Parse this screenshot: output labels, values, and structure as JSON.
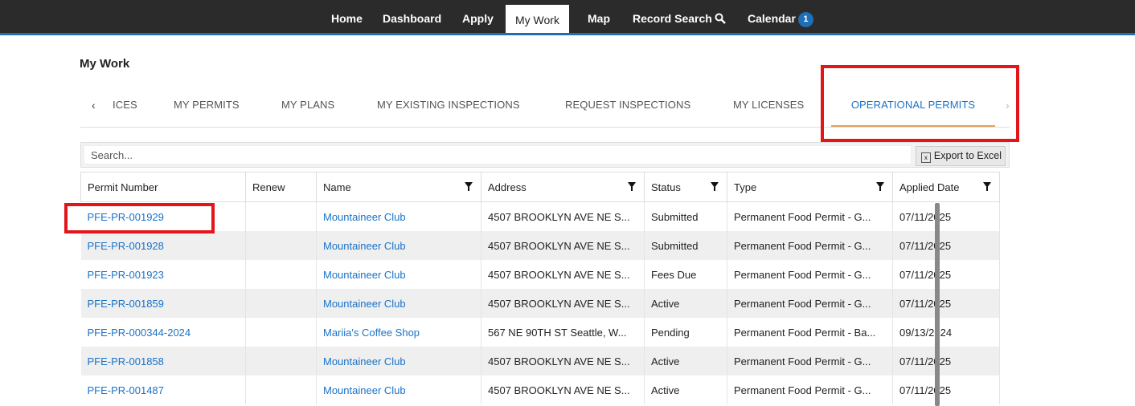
{
  "nav": {
    "items": [
      {
        "label": "Home"
      },
      {
        "label": "Dashboard"
      },
      {
        "label": "Apply"
      },
      {
        "label": "My Work"
      },
      {
        "label": "Map"
      },
      {
        "label": "Record Search"
      },
      {
        "label": "Calendar"
      }
    ],
    "calendar_badge": "1",
    "active": "My Work"
  },
  "page": {
    "title": "My Work"
  },
  "tabs": {
    "items": [
      {
        "label": "ICES"
      },
      {
        "label": "MY PERMITS"
      },
      {
        "label": "MY PLANS"
      },
      {
        "label": "MY EXISTING INSPECTIONS"
      },
      {
        "label": "REQUEST INSPECTIONS"
      },
      {
        "label": "MY LICENSES"
      },
      {
        "label": "OPERATIONAL PERMITS"
      }
    ],
    "active": "OPERATIONAL PERMITS"
  },
  "toolbar": {
    "search_placeholder": "Search...",
    "export_label": "Export to Excel"
  },
  "grid": {
    "columns": [
      "Permit Number",
      "Renew",
      "Name",
      "Address",
      "Status",
      "Type",
      "Applied Date"
    ],
    "rows": [
      [
        "PFE-PR-001929",
        "",
        "Mountaineer Club",
        "4507 BROOKLYN AVE NE S...",
        "Submitted",
        "Permanent Food Permit - G...",
        "07/11/2025"
      ],
      [
        "PFE-PR-001928",
        "",
        "Mountaineer Club",
        "4507 BROOKLYN AVE NE S...",
        "Submitted",
        "Permanent Food Permit - G...",
        "07/11/2025"
      ],
      [
        "PFE-PR-001923",
        "",
        "Mountaineer Club",
        "4507 BROOKLYN AVE NE S...",
        "Fees Due",
        "Permanent Food Permit - G...",
        "07/11/2025"
      ],
      [
        "PFE-PR-001859",
        "",
        "Mountaineer Club",
        "4507 BROOKLYN AVE NE S...",
        "Active",
        "Permanent Food Permit - G...",
        "07/11/2025"
      ],
      [
        "PFE-PR-000344-2024",
        "",
        "Mariia's Coffee Shop",
        "567 NE 90TH ST Seattle, W...",
        "Pending",
        "Permanent Food Permit - Ba...",
        "09/13/2024"
      ],
      [
        "PFE-PR-001858",
        "",
        "Mountaineer Club",
        "4507 BROOKLYN AVE NE S...",
        "Active",
        "Permanent Food Permit - G...",
        "07/11/2025"
      ],
      [
        "PFE-PR-001487",
        "",
        "Mountaineer Club",
        "4507 BROOKLYN AVE NE S...",
        "Active",
        "Permanent Food Permit - G...",
        "07/11/2025"
      ]
    ]
  },
  "colors": {
    "nav_bg": "#2b2b2b",
    "accent": "#1e6fb8",
    "link": "#1a73c8",
    "tab_underline": "#e8a15a",
    "highlight_box": "#e3151a"
  },
  "icons": {
    "record_search": "search-icon",
    "export": "excel-icon",
    "filter": "filter-icon",
    "tab_left": "chevron-left-icon",
    "tab_right": "chevron-right-icon"
  }
}
